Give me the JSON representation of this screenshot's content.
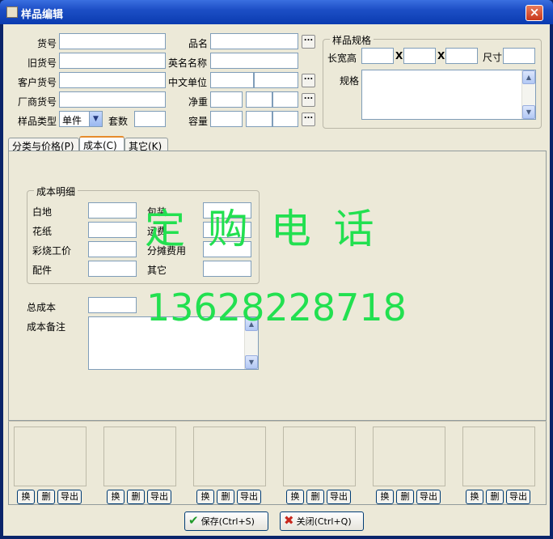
{
  "window": {
    "title": "样品编辑",
    "close_glyph": "×"
  },
  "form": {
    "item_no_label": "货号",
    "old_item_no_label": "旧货号",
    "customer_item_no_label": "客户货号",
    "vendor_item_no_label": "厂商货号",
    "sample_type_label": "样品类型",
    "sample_type_value": "单件",
    "set_count_label": "套数",
    "name_label": "品名",
    "en_name_label": "英名名称",
    "cn_unit_label": "中文单位",
    "net_weight_label": "净重",
    "volume_label": "容量",
    "dots": "..."
  },
  "spec": {
    "group_title": "样品规格",
    "lwh_label": "长宽高",
    "x1": "X",
    "x2": "X",
    "size_label": "尺寸",
    "spec_label": "规格"
  },
  "tabs": [
    {
      "label": "分类与价格(P)"
    },
    {
      "label": "成本(C)"
    },
    {
      "label": "其它(K)"
    }
  ],
  "cost": {
    "group_title": "成本明细",
    "white_base": "白地",
    "decal": "花纸",
    "painting_labor": "彩烧工价",
    "parts": "配件",
    "packing": "包装",
    "freight": "运费",
    "shared_cost": "分摊费用",
    "other": "其它",
    "total_cost": "总成本",
    "cost_note": "成本备注"
  },
  "overlay": {
    "order_text": "定 购 电 话",
    "phone": "13628228718"
  },
  "image_slots": [
    {
      "swap": "换",
      "delete": "删",
      "export": "导出"
    },
    {
      "swap": "换",
      "delete": "删",
      "export": "导出"
    },
    {
      "swap": "换",
      "delete": "删",
      "export": "导出"
    },
    {
      "swap": "换",
      "delete": "删",
      "export": "导出"
    },
    {
      "swap": "换",
      "delete": "删",
      "export": "导出"
    },
    {
      "swap": "换",
      "delete": "删",
      "export": "导出"
    }
  ],
  "actions": {
    "save_label": "保存(Ctrl+S)",
    "close_label": "关闭(Ctrl+Q)"
  },
  "colors": {
    "overlay_green": "#22e050",
    "title_blue": "#1d4fc6"
  }
}
